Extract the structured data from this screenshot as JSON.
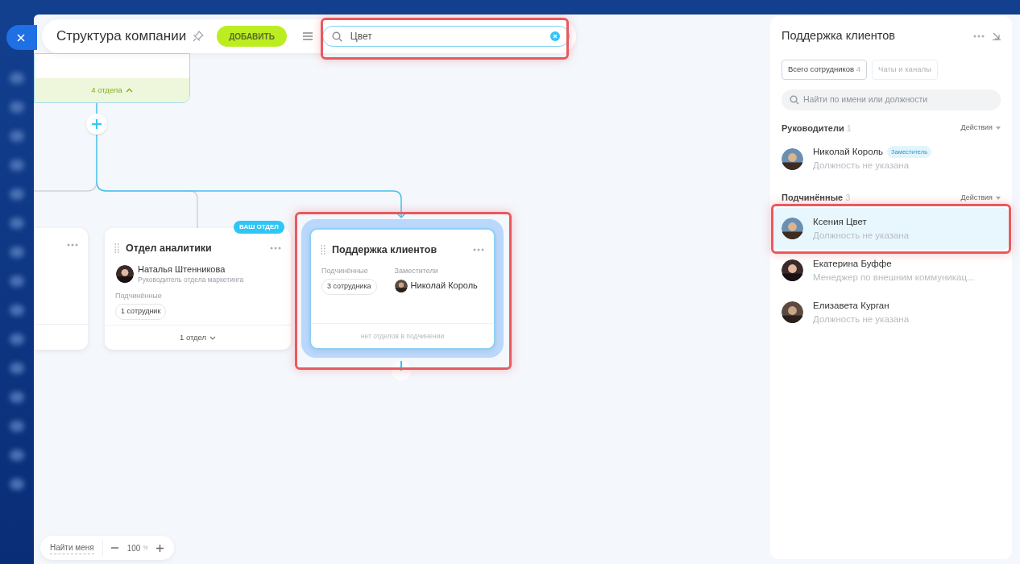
{
  "header": {
    "title": "Структура компании",
    "add_button": "ДОБАВИТЬ",
    "search": {
      "value": "Цвет"
    }
  },
  "top_card": {
    "footer": "4 отдела",
    "expanded": true
  },
  "cards": [
    {
      "title": "Отдел аналитики",
      "badge": "ВАШ ОТДЕЛ",
      "head": {
        "name": "Наталья Штенникова",
        "role": "Руководитель отдела маркетинга"
      },
      "subordinates_label": "Подчинённые",
      "subordinates_count": "1 сотрудник",
      "footer": "1 отдел",
      "highlighted": false
    },
    {
      "title": "Поддержка клиентов",
      "subordinates_label": "Подчинённые",
      "subordinates_count": "3 сотрудника",
      "deputies_label": "Заместители",
      "deputy": "Николай Король",
      "footer": "нет отделов в подчинении",
      "highlighted": true
    }
  ],
  "zoom_controls": {
    "find_me": "Найти меня",
    "level": "100",
    "unit": "%"
  },
  "panel": {
    "title": "Поддержка клиентов",
    "tabs": [
      {
        "label": "Всего сотрудников",
        "count": "4",
        "selected": true
      },
      {
        "label": "Чаты и каналы",
        "selected": false
      }
    ],
    "search": {
      "placeholder": "Найти по имени или должности"
    },
    "sections": [
      {
        "title": "Руководители",
        "count": "1",
        "action": "Действия",
        "people": [
          {
            "name": "Николай Король",
            "badge": "Заместитель",
            "role": "Должность не указана",
            "selected": false
          }
        ]
      },
      {
        "title": "Подчинённые",
        "count": "3",
        "action": "Действия",
        "people": [
          {
            "name": "Ксения Цвет",
            "role": "Должность не указана",
            "selected": true
          },
          {
            "name": "Екатерина Буффе",
            "role": "Менеджер по внешним коммуникац...",
            "selected": false
          },
          {
            "name": "Елизавета Курган",
            "role": "Должность не указана",
            "selected": false
          }
        ]
      }
    ]
  }
}
